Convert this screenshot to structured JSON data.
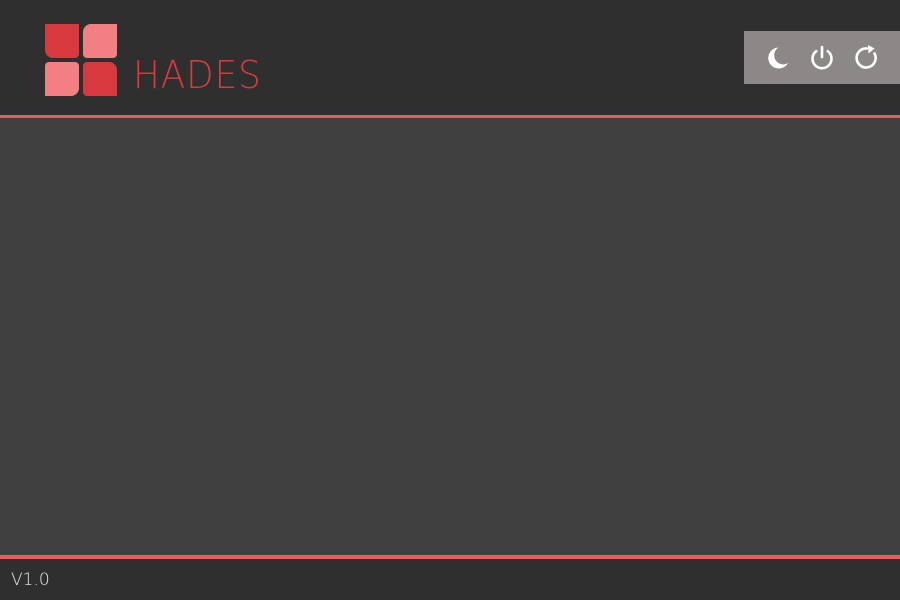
{
  "app": {
    "name": "HADES",
    "version": "V1.0"
  },
  "controls": {
    "sleep_icon": "moon-icon",
    "power_icon": "power-icon",
    "restart_icon": "restart-icon"
  },
  "colors": {
    "accent": "#f05a5a",
    "brand_red": "#d8393e",
    "brand_pink": "#f27f81",
    "header_bg": "#2f2f2f",
    "content_bg": "#404040",
    "controls_bg": "#8c8888"
  }
}
